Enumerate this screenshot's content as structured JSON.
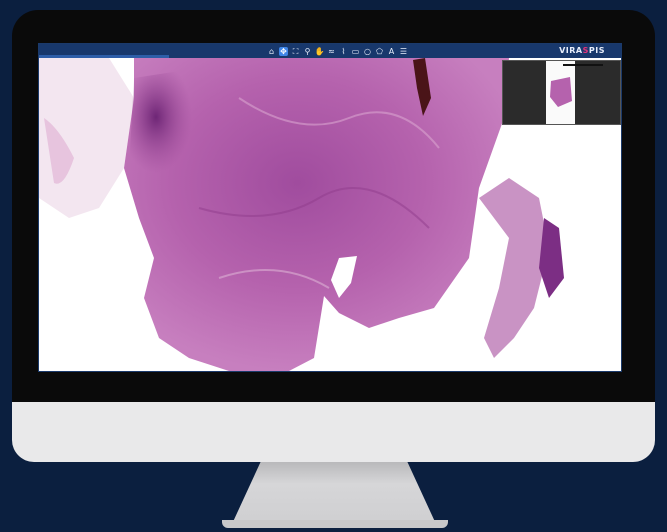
{
  "app": {
    "brand_name_left": "VIRA",
    "brand_name_mark": "S",
    "brand_name_right": "PIS"
  },
  "toolbar": {
    "tools": [
      {
        "name": "home-icon",
        "glyph": "⌂",
        "active": false
      },
      {
        "name": "move-icon",
        "glyph": "✥",
        "active": true
      },
      {
        "name": "fullscreen-icon",
        "glyph": "⛶",
        "active": false
      },
      {
        "name": "zoom-icon",
        "glyph": "⚲",
        "active": false
      },
      {
        "name": "hand-icon",
        "glyph": "✋",
        "active": false
      },
      {
        "name": "freehand-icon",
        "glyph": "≈",
        "active": false
      },
      {
        "name": "polyline-icon",
        "glyph": "⌇",
        "active": false
      },
      {
        "name": "rectangle-icon",
        "glyph": "▭",
        "active": false
      },
      {
        "name": "circle-icon",
        "glyph": "○",
        "active": false
      },
      {
        "name": "polygon-icon",
        "glyph": "⬠",
        "active": false
      },
      {
        "name": "text-annotation-icon",
        "glyph": "A",
        "active": false
      },
      {
        "name": "list-icon",
        "glyph": "☰",
        "active": false
      }
    ]
  },
  "colors": {
    "background": "#0b1f3f",
    "toolbar": "#18386c",
    "active_tool": "#3f86e8",
    "tissue_dark": "#7c2e84",
    "tissue_light": "#c77fbf",
    "brand_accent": "#e6337a"
  }
}
